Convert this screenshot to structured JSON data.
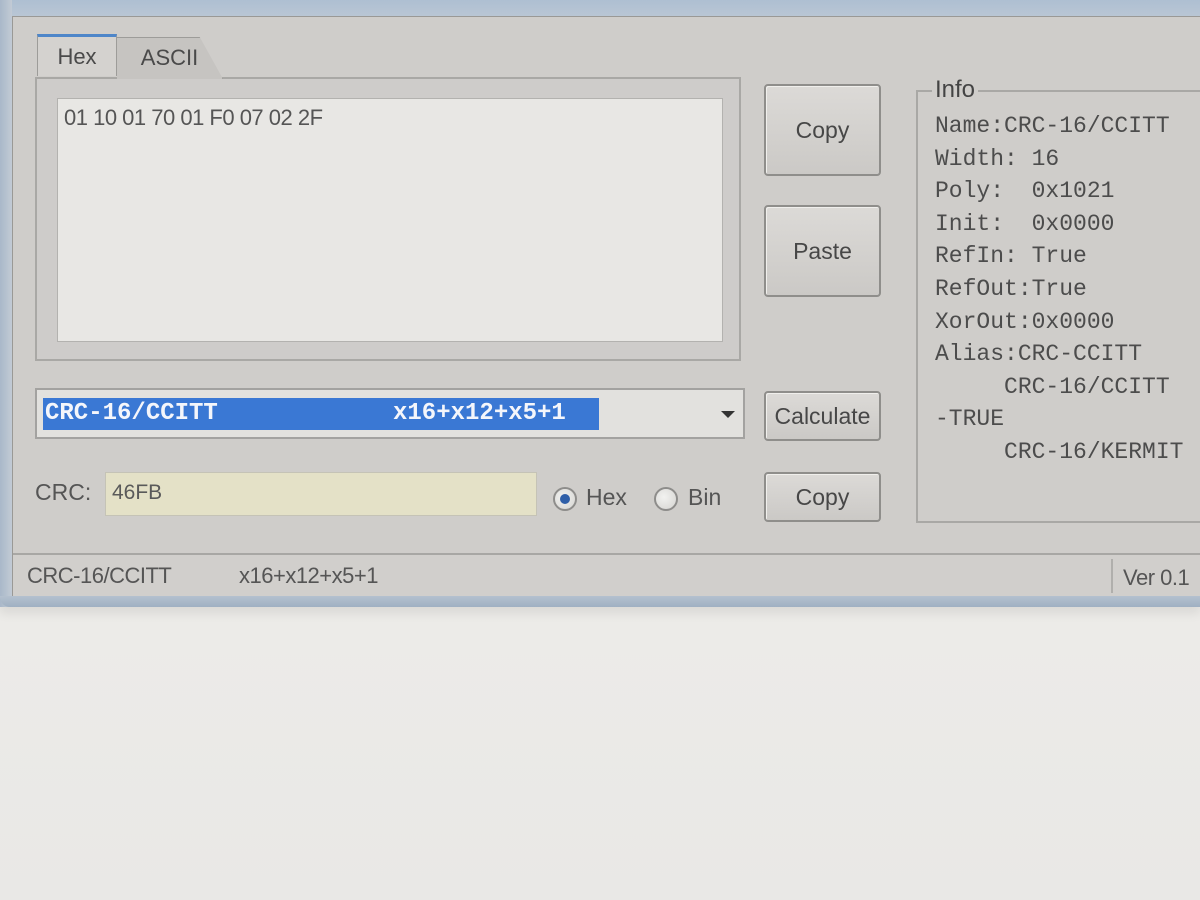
{
  "tabs": [
    {
      "label": "Hex",
      "active": true
    },
    {
      "label": "ASCII",
      "active": false
    }
  ],
  "input": {
    "hex_value": "01 10 01 70 01 F0 07 02 2F"
  },
  "buttons": {
    "copy_input": "Copy",
    "paste": "Paste",
    "calculate": "Calculate",
    "copy_crc": "Copy"
  },
  "info": {
    "title": "Info",
    "lines": [
      "Name:CRC-16/CCITT",
      "Width: 16",
      "Poly:  0x1021",
      "Init:  0x0000",
      "RefIn: True",
      "RefOut:True",
      "XorOut:0x0000",
      "Alias:CRC-CCITT",
      "     CRC-16/CCITT",
      "-TRUE",
      "     CRC-16/KERMIT"
    ]
  },
  "algorithm": {
    "selected_name": "CRC-16/CCITT",
    "selected_poly": "x16+x12+x5+1"
  },
  "crc": {
    "label": "CRC:",
    "value": "46FB",
    "format_options": [
      "Hex",
      "Bin"
    ],
    "selected_format": "Hex"
  },
  "status": {
    "name": "CRC-16/CCITT",
    "poly": "x16+x12+x5+1",
    "version": "Ver 0.1"
  },
  "colors": {
    "selection": "#3a78d4",
    "tab_accent": "#4e86c9",
    "crc_field": "#e4e1c7"
  }
}
